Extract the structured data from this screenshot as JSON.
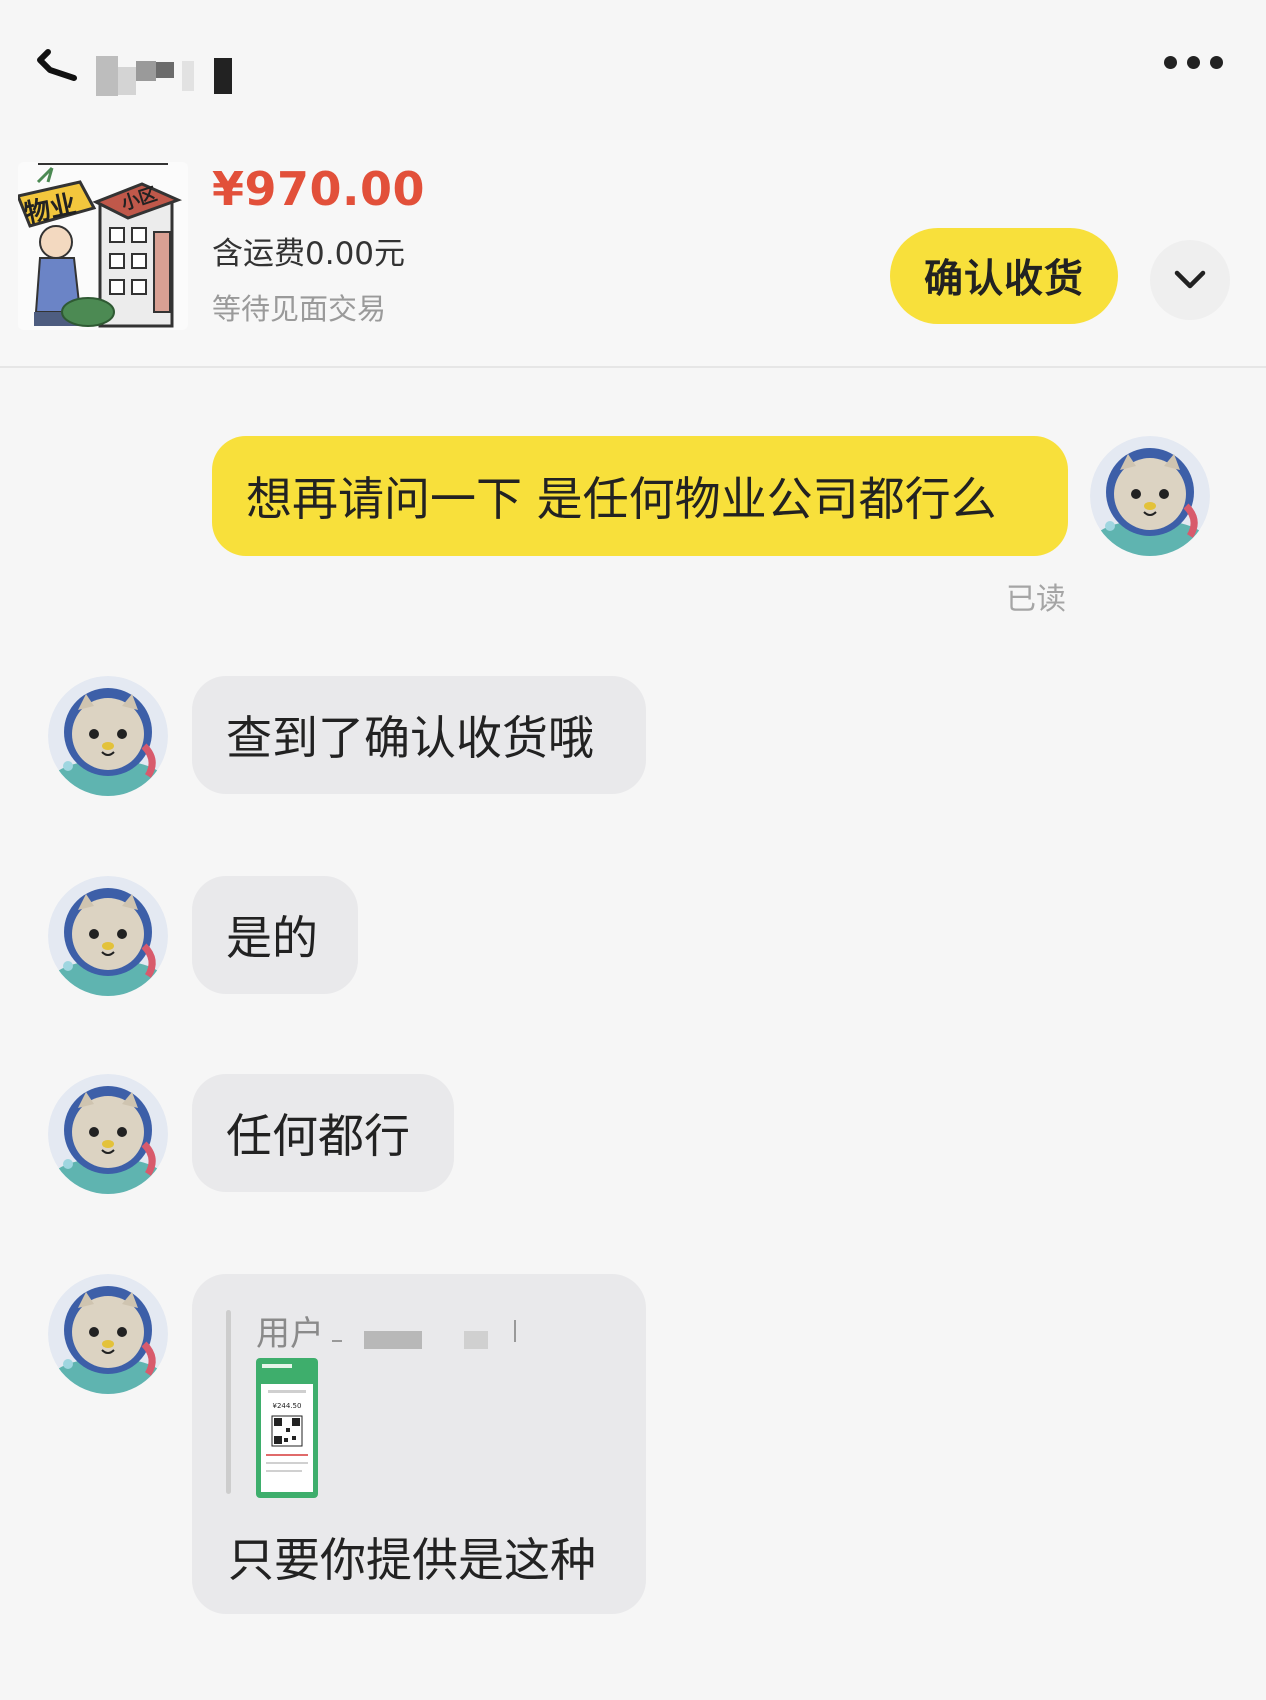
{
  "header": {
    "back_icon": "back-arrow-icon",
    "more_icon": "more-dots-icon"
  },
  "product": {
    "price": "¥970.00",
    "shipping": "含运费0.00元",
    "status": "等待见面交易",
    "thumb_text_1": "物业",
    "thumb_text_2": "小区",
    "confirm_label": "确认收货",
    "expand_icon": "chevron-down-icon"
  },
  "chat": {
    "messages": [
      {
        "from": "me",
        "text": "想再请问一下 是任何物业公司都行么"
      },
      {
        "from": "them",
        "text": "查到了确认收货哦"
      },
      {
        "from": "them",
        "text": "是的"
      },
      {
        "from": "them",
        "text": "任何都行"
      }
    ],
    "read_receipt": "已读",
    "quote": {
      "user_prefix": "用户",
      "text": "只要你提供是这种",
      "thumb_amount": "¥244.50"
    }
  },
  "colors": {
    "accent_yellow": "#f8e03b",
    "price_red": "#e2503a",
    "bubble_gray": "#e9e9eb",
    "background": "#f6f6f6"
  }
}
